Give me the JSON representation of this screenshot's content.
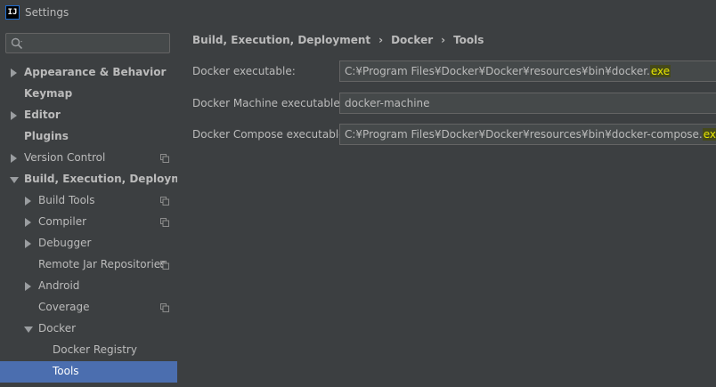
{
  "window": {
    "title": "Settings",
    "icon_text": "IJ"
  },
  "search": {
    "placeholder": "",
    "value": ""
  },
  "sidebar": {
    "items": [
      {
        "label": "Appearance & Behavior",
        "expander": "collapsed",
        "bold": true,
        "copy": false,
        "selected": false
      },
      {
        "label": "Keymap",
        "expander": "none",
        "bold": true,
        "copy": false,
        "selected": false
      },
      {
        "label": "Editor",
        "expander": "collapsed",
        "bold": true,
        "copy": false,
        "selected": false
      },
      {
        "label": "Plugins",
        "expander": "none",
        "bold": true,
        "copy": false,
        "selected": false
      },
      {
        "label": "Version Control",
        "expander": "collapsed",
        "bold": false,
        "copy": true,
        "selected": false
      },
      {
        "label": "Build, Execution, Deployment",
        "expander": "expanded",
        "bold": true,
        "copy": false,
        "selected": false
      },
      {
        "label": "Build Tools",
        "expander": "collapsed",
        "bold": false,
        "copy": true,
        "selected": false
      },
      {
        "label": "Compiler",
        "expander": "collapsed",
        "bold": false,
        "copy": true,
        "selected": false
      },
      {
        "label": "Debugger",
        "expander": "collapsed",
        "bold": false,
        "copy": false,
        "selected": false
      },
      {
        "label": "Remote Jar Repositories",
        "expander": "none",
        "bold": false,
        "copy": true,
        "selected": false
      },
      {
        "label": "Android",
        "expander": "collapsed",
        "bold": false,
        "copy": false,
        "selected": false
      },
      {
        "label": "Coverage",
        "expander": "none",
        "bold": false,
        "copy": true,
        "selected": false
      },
      {
        "label": "Docker",
        "expander": "expanded",
        "bold": false,
        "copy": false,
        "selected": false
      },
      {
        "label": "Docker Registry",
        "expander": "none",
        "bold": false,
        "copy": false,
        "selected": false
      },
      {
        "label": "Tools",
        "expander": "none",
        "bold": false,
        "copy": false,
        "selected": true
      }
    ]
  },
  "breadcrumb": {
    "items": [
      "Build, Execution, Deployment",
      "Docker",
      "Tools"
    ],
    "separator": "›"
  },
  "form": {
    "docker_executable": {
      "label": "Docker executable:",
      "value_prefix": "C:¥Program Files¥Docker¥Docker¥resources¥bin¥docker.",
      "value_highlight": "exe"
    },
    "docker_machine_executable": {
      "label": "Docker Machine executable:",
      "value": "docker-machine"
    },
    "docker_compose_executable": {
      "label": "Docker Compose executable:",
      "value_prefix": "C:¥Program Files¥Docker¥Docker¥resources¥bin¥docker-compose.",
      "value_highlight": "exe"
    }
  },
  "colors": {
    "background": "#3c3f41",
    "selection": "#4b6eaf",
    "field_background": "#45494a",
    "field_border": "#646464",
    "text": "#bbbbbb",
    "highlight_text": "#e6e600"
  }
}
